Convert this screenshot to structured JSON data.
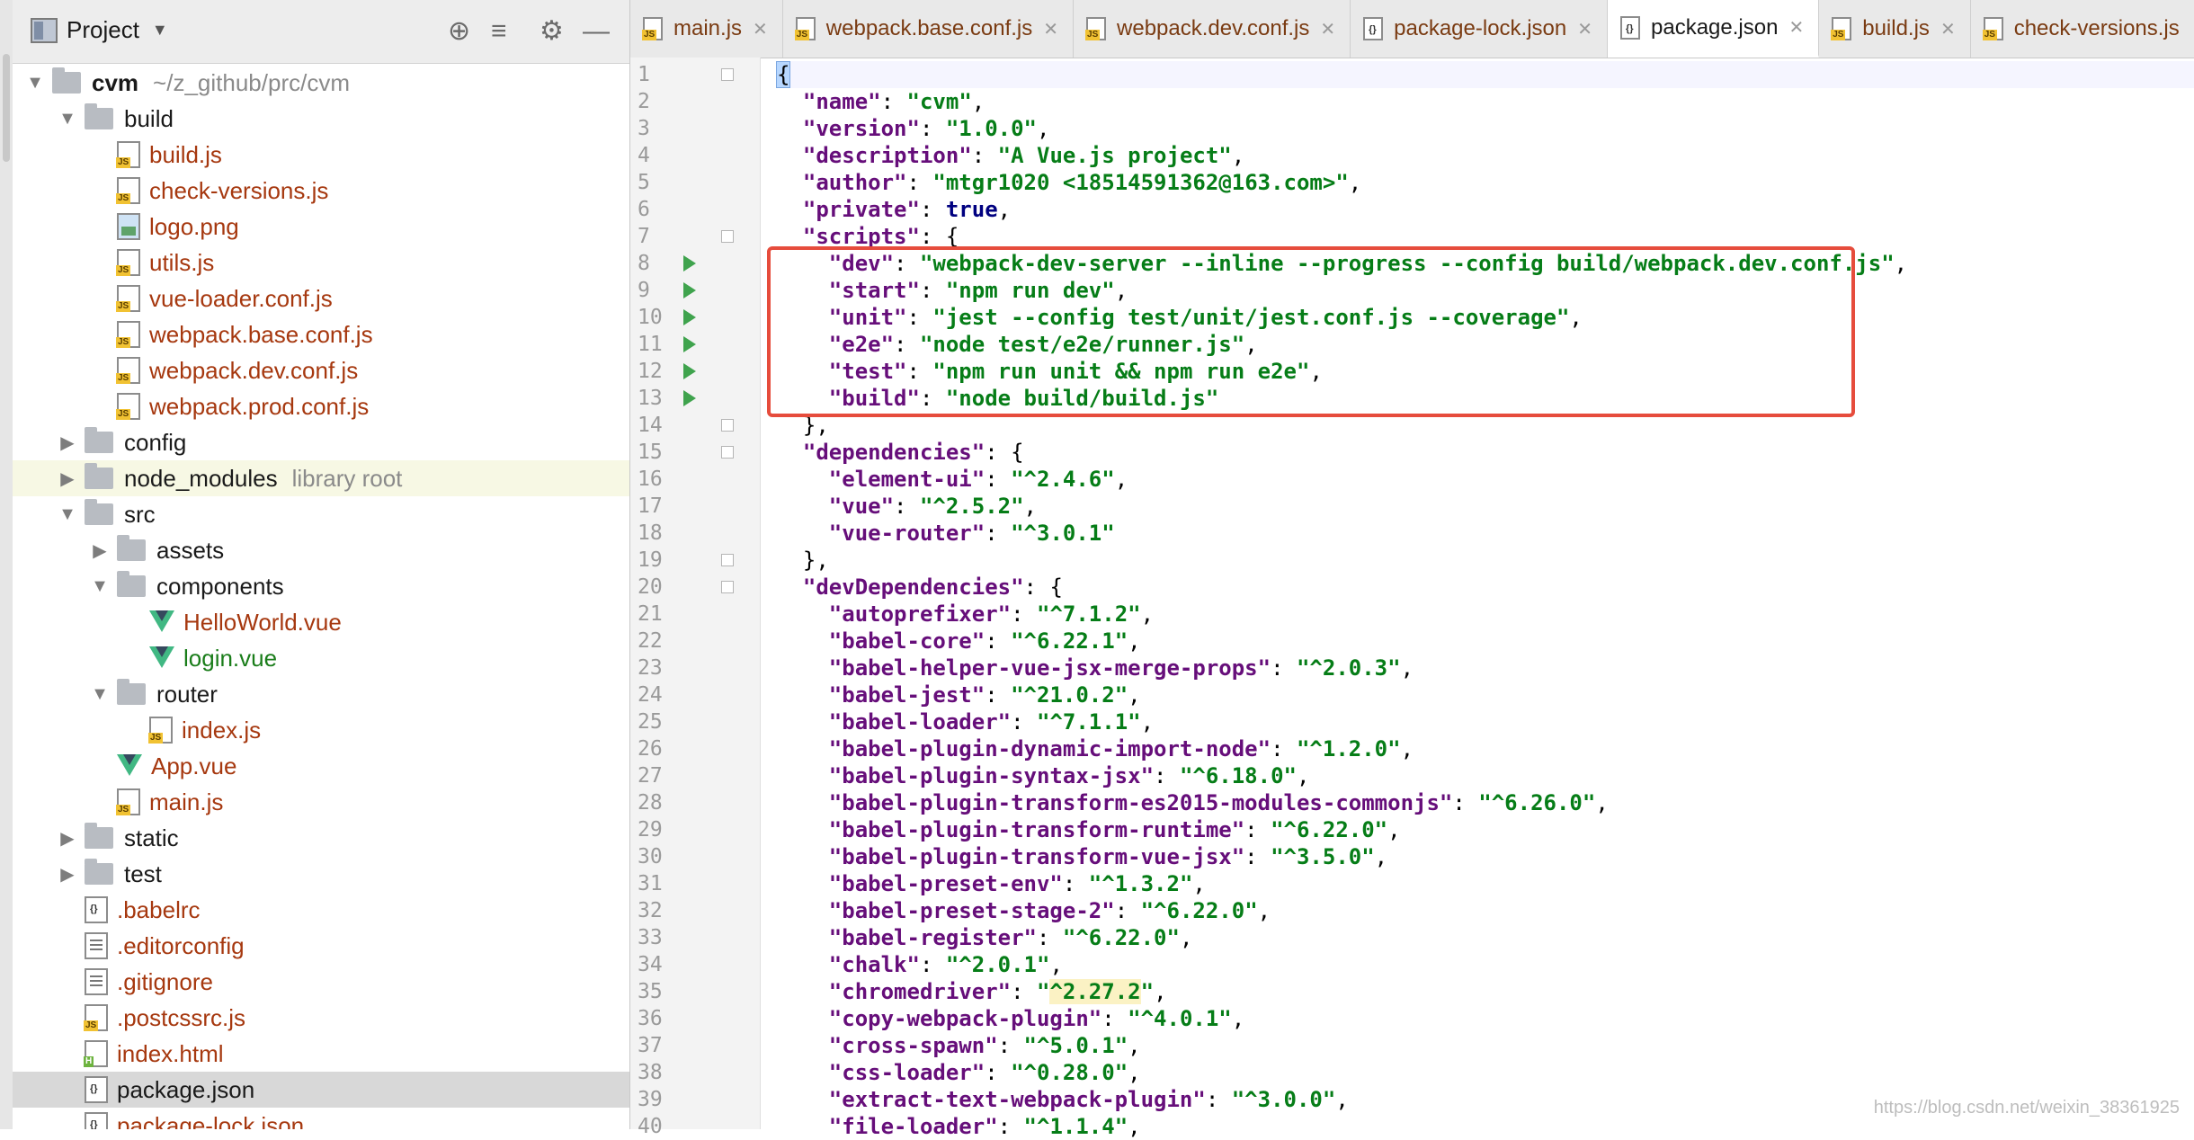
{
  "project_panel": {
    "title": "Project",
    "header_icons": [
      "crosshair-icon",
      "collapse-icon",
      "gear-icon",
      "minimize-icon"
    ],
    "tree": [
      {
        "label": "cvm",
        "meta": "~/z_github/prc/cvm",
        "type": "folder",
        "expanded": true,
        "depth": 0,
        "bold": true
      },
      {
        "label": "build",
        "type": "folder",
        "expanded": true,
        "depth": 1
      },
      {
        "label": "build.js",
        "type": "js",
        "depth": 2
      },
      {
        "label": "check-versions.js",
        "type": "js",
        "depth": 2
      },
      {
        "label": "logo.png",
        "type": "png",
        "depth": 2
      },
      {
        "label": "utils.js",
        "type": "js",
        "depth": 2
      },
      {
        "label": "vue-loader.conf.js",
        "type": "js",
        "depth": 2
      },
      {
        "label": "webpack.base.conf.js",
        "type": "js",
        "depth": 2
      },
      {
        "label": "webpack.dev.conf.js",
        "type": "js",
        "depth": 2
      },
      {
        "label": "webpack.prod.conf.js",
        "type": "js",
        "depth": 2
      },
      {
        "label": "config",
        "type": "folder",
        "expanded": false,
        "depth": 1
      },
      {
        "label": "node_modules",
        "meta": "library root",
        "type": "folder",
        "expanded": false,
        "depth": 1,
        "highlighted": true
      },
      {
        "label": "src",
        "type": "folder",
        "expanded": true,
        "depth": 1
      },
      {
        "label": "assets",
        "type": "folder",
        "expanded": false,
        "depth": 2
      },
      {
        "label": "components",
        "type": "folder",
        "expanded": true,
        "depth": 2
      },
      {
        "label": "HelloWorld.vue",
        "type": "vue",
        "depth": 3
      },
      {
        "label": "login.vue",
        "type": "vue",
        "depth": 3,
        "green": true
      },
      {
        "label": "router",
        "type": "folder",
        "expanded": true,
        "depth": 2
      },
      {
        "label": "index.js",
        "type": "js",
        "depth": 3
      },
      {
        "label": "App.vue",
        "type": "vue",
        "depth": 2
      },
      {
        "label": "main.js",
        "type": "js",
        "depth": 2
      },
      {
        "label": "static",
        "type": "folder",
        "expanded": false,
        "depth": 1
      },
      {
        "label": "test",
        "type": "folder",
        "expanded": false,
        "depth": 1
      },
      {
        "label": ".babelrc",
        "type": "json",
        "depth": 1
      },
      {
        "label": ".editorconfig",
        "type": "txt",
        "depth": 1
      },
      {
        "label": ".gitignore",
        "type": "txt",
        "depth": 1
      },
      {
        "label": ".postcssrc.js",
        "type": "js",
        "depth": 1
      },
      {
        "label": "index.html",
        "type": "html",
        "depth": 1
      },
      {
        "label": "package.json",
        "type": "json",
        "depth": 1,
        "selected": true,
        "dark": true
      },
      {
        "label": "package-lock.json",
        "type": "json",
        "depth": 1
      }
    ]
  },
  "tabs": [
    {
      "label": "main.js",
      "type": "js"
    },
    {
      "label": "webpack.base.conf.js",
      "type": "js"
    },
    {
      "label": "webpack.dev.conf.js",
      "type": "js"
    },
    {
      "label": "package-lock.json",
      "type": "json"
    },
    {
      "label": "package.json",
      "type": "json",
      "active": true
    },
    {
      "label": "build.js",
      "type": "js"
    },
    {
      "label": "check-versions.js",
      "type": "js"
    }
  ],
  "editor": {
    "run_lines": [
      8,
      9,
      10,
      11,
      12,
      13
    ],
    "fold_lines": [
      1,
      7,
      14,
      15,
      19,
      20
    ],
    "lines": [
      "{",
      "  \"name\": \"cvm\",",
      "  \"version\": \"1.0.0\",",
      "  \"description\": \"A Vue.js project\",",
      "  \"author\": \"mtgr1020 <18514591362@163.com>\",",
      "  \"private\": true,",
      "  \"scripts\": {",
      "    \"dev\": \"webpack-dev-server --inline --progress --config build/webpack.dev.conf.js\",",
      "    \"start\": \"npm run dev\",",
      "    \"unit\": \"jest --config test/unit/jest.conf.js --coverage\",",
      "    \"e2e\": \"node test/e2e/runner.js\",",
      "    \"test\": \"npm run unit && npm run e2e\",",
      "    \"build\": \"node build/build.js\"",
      "  },",
      "  \"dependencies\": {",
      "    \"element-ui\": \"^2.4.6\",",
      "    \"vue\": \"^2.5.2\",",
      "    \"vue-router\": \"^3.0.1\"",
      "  },",
      "  \"devDependencies\": {",
      "    \"autoprefixer\": \"^7.1.2\",",
      "    \"babel-core\": \"^6.22.1\",",
      "    \"babel-helper-vue-jsx-merge-props\": \"^2.0.3\",",
      "    \"babel-jest\": \"^21.0.2\",",
      "    \"babel-loader\": \"^7.1.1\",",
      "    \"babel-plugin-dynamic-import-node\": \"^1.2.0\",",
      "    \"babel-plugin-syntax-jsx\": \"^6.18.0\",",
      "    \"babel-plugin-transform-es2015-modules-commonjs\": \"^6.26.0\",",
      "    \"babel-plugin-transform-runtime\": \"^6.22.0\",",
      "    \"babel-plugin-transform-vue-jsx\": \"^3.5.0\",",
      "    \"babel-preset-env\": \"^1.3.2\",",
      "    \"babel-preset-stage-2\": \"^6.22.0\",",
      "    \"babel-register\": \"^6.22.0\",",
      "    \"chalk\": \"^2.0.1\",",
      "    \"chromedriver\": \"^2.27.2\",",
      "    \"copy-webpack-plugin\": \"^4.0.1\",",
      "    \"cross-spawn\": \"^5.0.1\",",
      "    \"css-loader\": \"^0.28.0\",",
      "    \"extract-text-webpack-plugin\": \"^3.0.0\",",
      "    \"file-loader\": \"^1.1.4\","
    ]
  },
  "watermark": "https://blog.csdn.net/weixin_38361925"
}
